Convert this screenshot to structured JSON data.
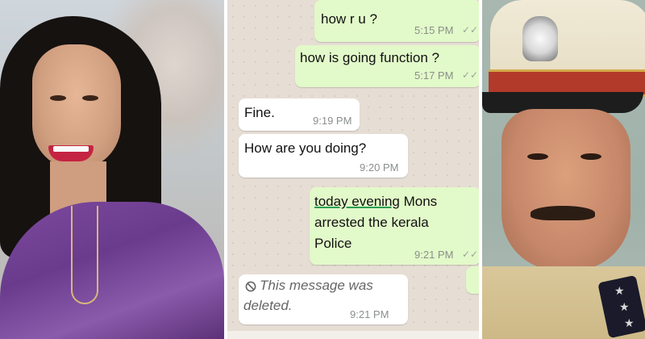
{
  "chat": {
    "messages": [
      {
        "direction": "outgoing",
        "text": "how r u ?",
        "time": "5:15 PM",
        "ticks": "✓✓"
      },
      {
        "direction": "outgoing",
        "text": "how is going function ?",
        "time": "5:17 PM",
        "ticks": "✓✓"
      },
      {
        "direction": "incoming",
        "text": "Fine.",
        "time": "9:19 PM"
      },
      {
        "direction": "incoming",
        "text": "How are you doing?",
        "time": "9:20 PM"
      },
      {
        "direction": "outgoing",
        "line1_underlined": "today  evening",
        "line1_rest": " Mons",
        "line2": "arrested the kerala",
        "line3": "Police",
        "time": "9:21 PM",
        "ticks": "✓✓"
      },
      {
        "direction": "incoming",
        "deleted": true,
        "icon": "ban-icon",
        "line1": "This message was",
        "line2": "deleted.",
        "time": "9:21 PM"
      }
    ]
  },
  "colors": {
    "outgoing_bubble": "#e2f9c9",
    "incoming_bubble": "#ffffff",
    "chat_background": "#e6ddd4",
    "saree": "#7d4a9e",
    "cap_band": "#b23a2b"
  }
}
